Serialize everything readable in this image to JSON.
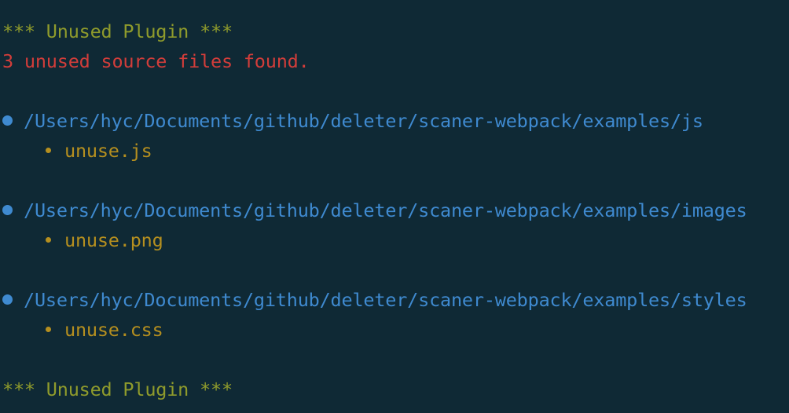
{
  "header": {
    "banner": "*** Unused Plugin ***",
    "summary": "3 unused source files found."
  },
  "groups": [
    {
      "path": "/Users/hyc/Documents/github/deleter/scaner-webpack/examples/js",
      "files": [
        "unuse.js"
      ]
    },
    {
      "path": "/Users/hyc/Documents/github/deleter/scaner-webpack/examples/images",
      "files": [
        "unuse.png"
      ]
    },
    {
      "path": "/Users/hyc/Documents/github/deleter/scaner-webpack/examples/styles",
      "files": [
        "unuse.css"
      ]
    }
  ],
  "footer": {
    "banner": "*** Unused Plugin ***"
  },
  "colors": {
    "background": "#0f2935",
    "banner": "#8f9b2c",
    "summary": "#d23d3a",
    "path": "#3f8ad0",
    "file": "#b58f1f"
  },
  "icons": {
    "group_marker": "blue-dot-icon",
    "file_marker": "bullet-icon"
  }
}
